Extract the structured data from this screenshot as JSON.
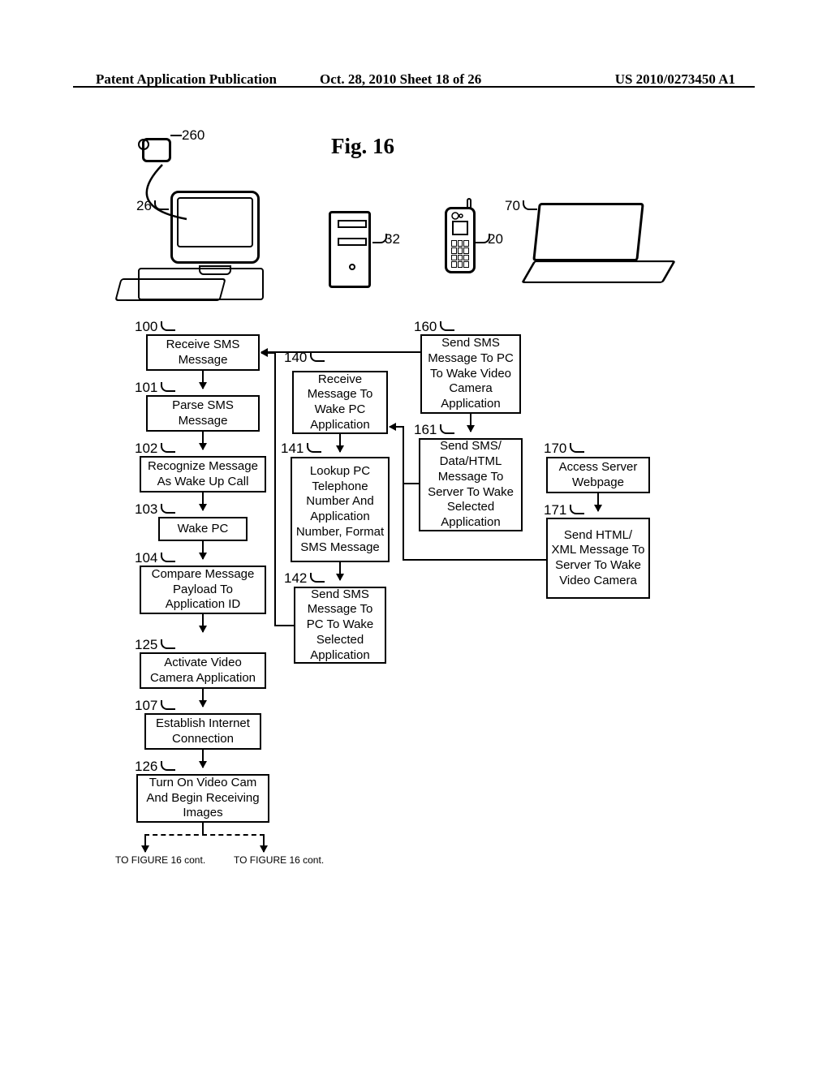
{
  "header": {
    "left": "Patent Application Publication",
    "center": "Oct. 28, 2010  Sheet 18 of 26",
    "right": "US 2010/0273450 A1"
  },
  "figure": {
    "title": "Fig. 16"
  },
  "refs": {
    "r260": "260",
    "r26": "26",
    "r32": "32",
    "r20": "20",
    "r70": "70",
    "r100": "100",
    "r101": "101",
    "r102": "102",
    "r103": "103",
    "r104": "104",
    "r125": "125",
    "r107": "107",
    "r126": "126",
    "r160": "160",
    "r161": "161",
    "r140": "140",
    "r141": "141",
    "r142": "142",
    "r170": "170",
    "r171": "171"
  },
  "boxes": {
    "b100": "Receive SMS Message",
    "b101": "Parse SMS Message",
    "b102": "Recognize Message As Wake Up Call",
    "b103": "Wake PC",
    "b104": "Compare Message Payload To Application ID",
    "b125": "Activate Video Camera Application",
    "b107": "Establish Internet Connection",
    "b126": "Turn On Video Cam And Begin Receiving Images",
    "b140": "Receive Message To Wake PC Application",
    "b141": "Lookup PC Telephone Number And Application Number, Format SMS Message",
    "b142": "Send SMS Message To PC To Wake Selected Application",
    "b160": "Send SMS Message To PC To Wake Video Camera Application",
    "b161": "Send SMS/ Data/HTML Message To Server To Wake Selected Application",
    "b170": "Access Server Webpage",
    "b171": "Send HTML/ XML Message To Server To Wake Video Camera"
  },
  "continuation": {
    "left": "TO FIGURE 16 cont.",
    "right": "TO FIGURE 16 cont."
  },
  "chart_data": {
    "type": "flowchart",
    "title": "Fig. 16",
    "devices": [
      {
        "id": 260,
        "label": "webcam"
      },
      {
        "id": 26,
        "label": "desktop PC (monitor+keyboard)"
      },
      {
        "id": 32,
        "label": "server tower"
      },
      {
        "id": 20,
        "label": "mobile phone"
      },
      {
        "id": 70,
        "label": "laptop"
      }
    ],
    "columns": {
      "pc": [
        {
          "id": 100,
          "text": "Receive SMS Message"
        },
        {
          "id": 101,
          "text": "Parse SMS Message"
        },
        {
          "id": 102,
          "text": "Recognize Message As Wake Up Call"
        },
        {
          "id": 103,
          "text": "Wake PC"
        },
        {
          "id": 104,
          "text": "Compare Message Payload To Application ID"
        },
        {
          "id": 125,
          "text": "Activate Video Camera Application"
        },
        {
          "id": 107,
          "text": "Establish Internet Connection"
        },
        {
          "id": 126,
          "text": "Turn On Video Cam And Begin Receiving Images"
        }
      ],
      "server": [
        {
          "id": 140,
          "text": "Receive Message To Wake PC Application"
        },
        {
          "id": 141,
          "text": "Lookup PC Telephone Number And Application Number, Format SMS Message"
        },
        {
          "id": 142,
          "text": "Send SMS Message To PC To Wake Selected Application"
        }
      ],
      "phone": [
        {
          "id": 160,
          "text": "Send SMS Message To PC To Wake Video Camera Application"
        },
        {
          "id": 161,
          "text": "Send SMS/ Data/HTML Message To Server To Wake Selected Application"
        }
      ],
      "laptop": [
        {
          "id": 170,
          "text": "Access Server Webpage"
        },
        {
          "id": 171,
          "text": "Send HTML/ XML Message To Server To Wake Video Camera"
        }
      ]
    },
    "cross_links": [
      {
        "from": 160,
        "to": 100,
        "dir": "left"
      },
      {
        "from": 161,
        "to": 140,
        "dir": "left"
      },
      {
        "from": 171,
        "to": 140,
        "dir": "left"
      },
      {
        "from": 142,
        "to": 100,
        "dir": "left"
      }
    ],
    "continuation_targets": [
      "TO FIGURE 16 cont.",
      "TO FIGURE 16 cont."
    ]
  }
}
